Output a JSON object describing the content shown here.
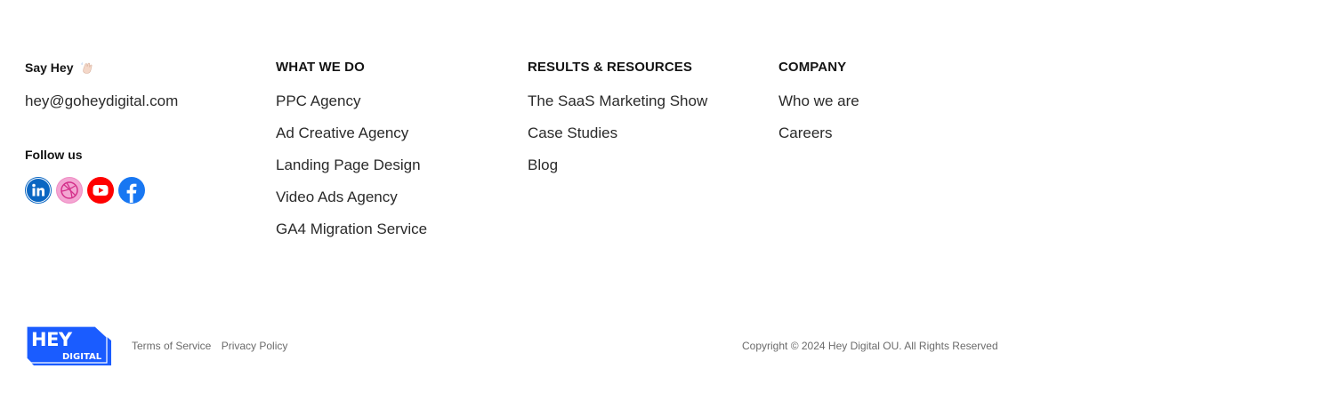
{
  "say_hey": {
    "heading": "Say Hey",
    "wave_icon": "waving-hand-icon",
    "email": "hey@goheydigital.com",
    "follow_heading": "Follow us",
    "socials": [
      {
        "name": "linkedin",
        "icon": "linkedin-icon",
        "color": "#0a66c2"
      },
      {
        "name": "dribbble",
        "icon": "dribbble-icon",
        "color": "#ea4c89"
      },
      {
        "name": "youtube",
        "icon": "youtube-icon",
        "color": "#ff0000"
      },
      {
        "name": "facebook",
        "icon": "facebook-icon",
        "color": "#1877f2"
      }
    ]
  },
  "what_we_do": {
    "heading": "WHAT WE DO",
    "items": [
      "PPC Agency",
      "Ad Creative Agency",
      "Landing Page Design",
      "Video Ads Agency",
      "GA4 Migration Service"
    ]
  },
  "results": {
    "heading": "RESULTS & RESOURCES",
    "items": [
      "The SaaS Marketing Show",
      "Case Studies",
      "Blog"
    ]
  },
  "company": {
    "heading": "COMPANY",
    "items": [
      "Who we are",
      "Careers"
    ]
  },
  "bottom": {
    "logo_text_top": "HEY",
    "logo_text_bottom": "DIGITAL",
    "logo_color": "#1a5cff",
    "terms": "Terms of Service",
    "privacy": "Privacy Policy",
    "copyright": "Copyright © 2024 Hey Digital OU.  All Rights Reserved"
  }
}
